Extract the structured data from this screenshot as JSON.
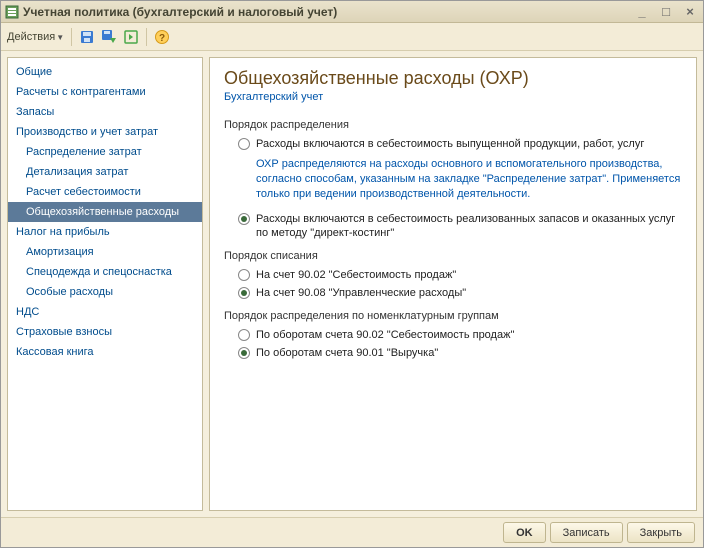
{
  "window": {
    "title": "Учетная политика (бухгалтерский и налоговый учет)"
  },
  "toolbar": {
    "actions_label": "Действия"
  },
  "nav": {
    "items": [
      {
        "label": "Общие",
        "indent": 0
      },
      {
        "label": "Расчеты с контрагентами",
        "indent": 0
      },
      {
        "label": "Запасы",
        "indent": 0
      },
      {
        "label": "Производство и учет затрат",
        "indent": 0
      },
      {
        "label": "Распределение затрат",
        "indent": 1
      },
      {
        "label": "Детализация затрат",
        "indent": 1
      },
      {
        "label": "Расчет себестоимости",
        "indent": 1
      },
      {
        "label": "Общехозяйственные расходы",
        "indent": 1,
        "selected": true
      },
      {
        "label": "Налог на прибыль",
        "indent": 0
      },
      {
        "label": "Амортизация",
        "indent": 1
      },
      {
        "label": "Спецодежда и спецоснастка",
        "indent": 1
      },
      {
        "label": "Особые расходы",
        "indent": 1
      },
      {
        "label": "НДС",
        "indent": 0
      },
      {
        "label": "Страховые взносы",
        "indent": 0
      },
      {
        "label": "Кассовая книга",
        "indent": 0
      }
    ]
  },
  "content": {
    "title": "Общехозяйственные расходы (ОХР)",
    "subtitle": "Бухгалтерский учет",
    "section1": {
      "label": "Порядок распределения",
      "opt1": "Расходы включаются в себестоимость выпущенной продукции, работ, услуг",
      "hint": "ОХР распределяются на расходы основного и вспомогательного производства, согласно способам, указанным на закладке \"Распределение затрат\". Применяется только при ведении производственной деятельности.",
      "opt2": "Расходы включаются в себестоимость реализованных запасов и оказанных услуг по методу \"директ-костинг\""
    },
    "section2": {
      "label": "Порядок списания",
      "opt1": "На счет 90.02 \"Себестоимость продаж\"",
      "opt2": "На счет 90.08 \"Управленческие расходы\""
    },
    "section3": {
      "label": "Порядок распределения по номенклатурным группам",
      "opt1": "По оборотам счета 90.02 \"Себестоимость продаж\"",
      "opt2": "По оборотам счета 90.01 \"Выручка\""
    }
  },
  "footer": {
    "ok": "OK",
    "save": "Записать",
    "close": "Закрыть"
  }
}
